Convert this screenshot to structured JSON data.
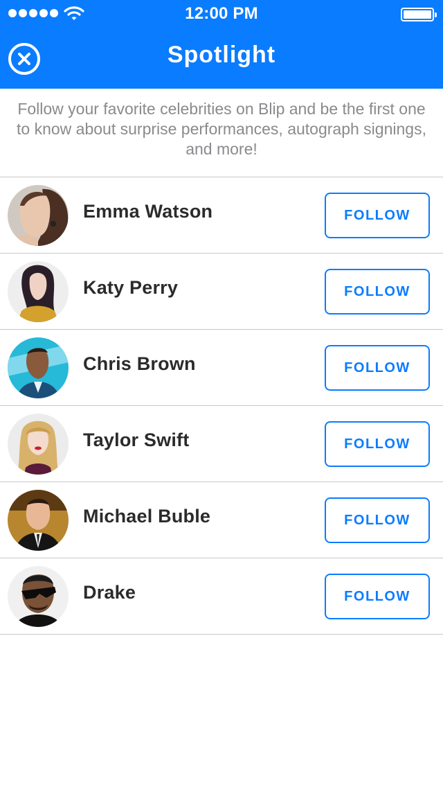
{
  "status_bar": {
    "time": "12:00 PM",
    "signal_bars": 5,
    "battery_fraction": 1.0
  },
  "header": {
    "title": "Spotlight",
    "close_icon": "close-circle-icon",
    "background_color": "#0a7cff"
  },
  "intro": {
    "text": "Follow your favorite celebrities on Blip and be the first one to know about surprise performances, autograph signings, and more!"
  },
  "celebrities": [
    {
      "name": "Emma Watson",
      "follow_label": "FOLLOW"
    },
    {
      "name": "Katy Perry",
      "follow_label": "FOLLOW"
    },
    {
      "name": "Chris Brown",
      "follow_label": "FOLLOW"
    },
    {
      "name": "Taylor Swift",
      "follow_label": "FOLLOW"
    },
    {
      "name": "Michael Buble",
      "follow_label": "FOLLOW"
    },
    {
      "name": "Drake",
      "follow_label": "FOLLOW"
    }
  ],
  "colors": {
    "accent": "#0a7cff",
    "separator": "#c8c8cc",
    "intro_text": "#8a8a8e",
    "name_text": "#2b2b2b"
  }
}
